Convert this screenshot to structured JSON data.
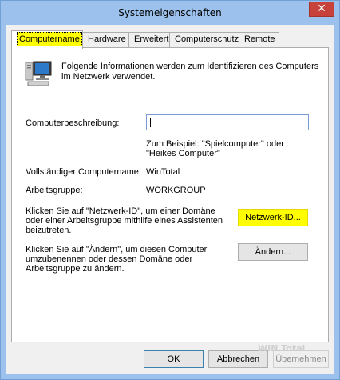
{
  "window": {
    "title": "Systemeigenschaften",
    "close_glyph": "✕"
  },
  "tabs": [
    {
      "label": "Computername",
      "active": true
    },
    {
      "label": "Hardware",
      "active": false
    },
    {
      "label": "Erweitert",
      "active": false
    },
    {
      "label": "Computerschutz",
      "active": false
    },
    {
      "label": "Remote",
      "active": false
    }
  ],
  "computername": {
    "intro_line1": "Folgende Informationen werden zum Identifizieren des Computers",
    "intro_line2": "im Netzwerk verwendet.",
    "description_label": "Computerbeschreibung:",
    "description_value": "",
    "example_line1": "Zum Beispiel: \"Spielcomputer\" oder",
    "example_line2": "\"Heikes Computer\"",
    "fullname_label": "Vollständiger Computername:",
    "fullname_value": "WinTotal",
    "workgroup_label": "Arbeitsgruppe:",
    "workgroup_value": "WORKGROUP",
    "network_text_line1": "Klicken Sie auf \"Netzwerk-ID\", um einer Domäne",
    "network_text_line2": "oder einer Arbeitsgruppe mithilfe eines Assistenten",
    "network_text_line3": "beizutreten.",
    "network_button": "Netzwerk-ID...",
    "change_text_line1": "Klicken Sie auf \"Ändern\", um diesen Computer",
    "change_text_line2": "umzubenennen oder dessen Domäne oder",
    "change_text_line3": "Arbeitsgruppe zu ändern.",
    "change_button": "Ändern..."
  },
  "footer": {
    "ok": "OK",
    "cancel": "Abbrechen",
    "apply": "Übernehmen"
  },
  "watermark": "WIN Total",
  "colors": {
    "highlight": "#ffff00",
    "titlebar": "#9cc1ec",
    "close": "#c7423a"
  },
  "icons": {
    "computer": "computer-monitor-icon",
    "close": "close-icon"
  }
}
